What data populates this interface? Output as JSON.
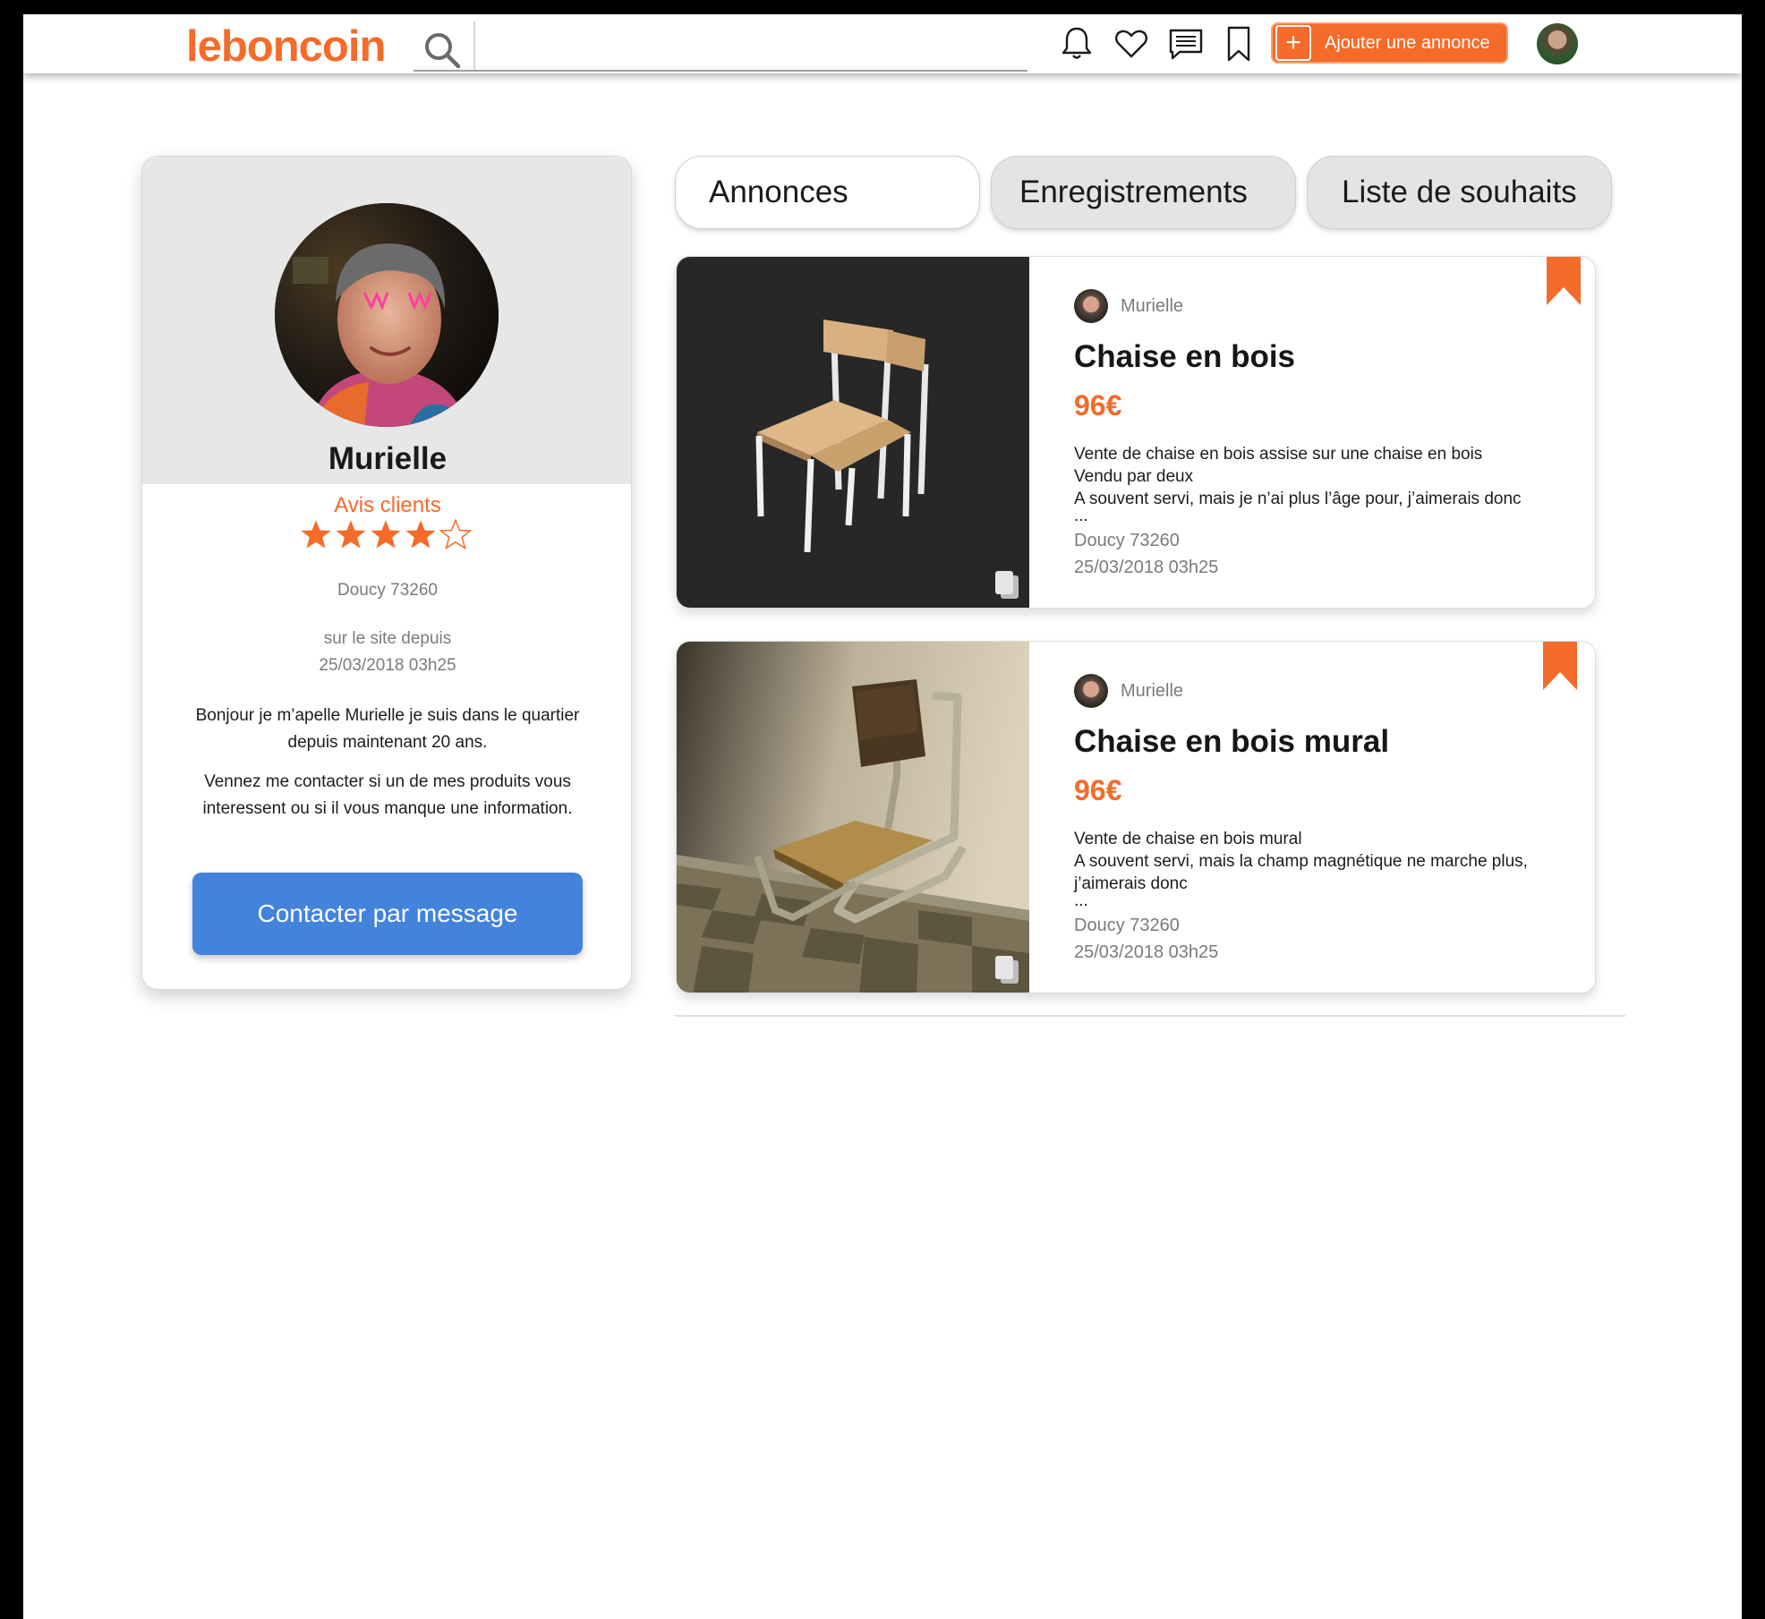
{
  "header": {
    "logo": "leboncoin",
    "search": {
      "placeholder": "",
      "value": ""
    },
    "icons": [
      "bell-icon",
      "heart-icon",
      "message-icon",
      "bookmark-icon"
    ],
    "add_button_label": "Ajouter une annonce"
  },
  "profile": {
    "name": "Murielle",
    "reviews_label": "Avis clients",
    "rating": 4,
    "rating_max": 5,
    "location": "Doucy 73260",
    "member_since_label": "sur le site depuis",
    "member_since_date": "25/03/2018 03h25",
    "bio_1": "Bonjour je m’apelle Murielle je suis dans le quartier depuis maintenant 20 ans.",
    "bio_2": "Vennez me contacter si un de mes produits vous interessent ou si il vous manque une information.",
    "contact_button_label": "Contacter par message"
  },
  "tabs": [
    {
      "label": "Annonces",
      "active": true
    },
    {
      "label": "Enregistrements",
      "active": false
    },
    {
      "label": "Liste de souhaits",
      "active": false
    }
  ],
  "listings": [
    {
      "seller": "Murielle",
      "title": "Chaise en bois",
      "price": "96€",
      "description_lines": [
        "Vente de chaise en bois assise sur une chaise en bois",
        "Vendu par deux",
        "A souvent servi, mais je n’ai plus l’âge pour, j’aimerais donc",
        "..."
      ],
      "location": "Doucy 73260",
      "date": "25/03/2018 03h25"
    },
    {
      "seller": "Murielle",
      "title": "Chaise en bois mural",
      "price": "96€",
      "description_lines": [
        "Vente de chaise en bois mural",
        "A souvent servi, mais la champ magnétique ne marche plus,",
        "j’aimerais donc",
        "..."
      ],
      "location": "Doucy 73260",
      "date": "25/03/2018 03h25"
    }
  ],
  "colors": {
    "brand_orange": "#f56b2a",
    "contact_blue": "#4383dc",
    "profile_header_gray": "#e7e7e7",
    "tab_inactive_gray": "#e4e4e4"
  }
}
